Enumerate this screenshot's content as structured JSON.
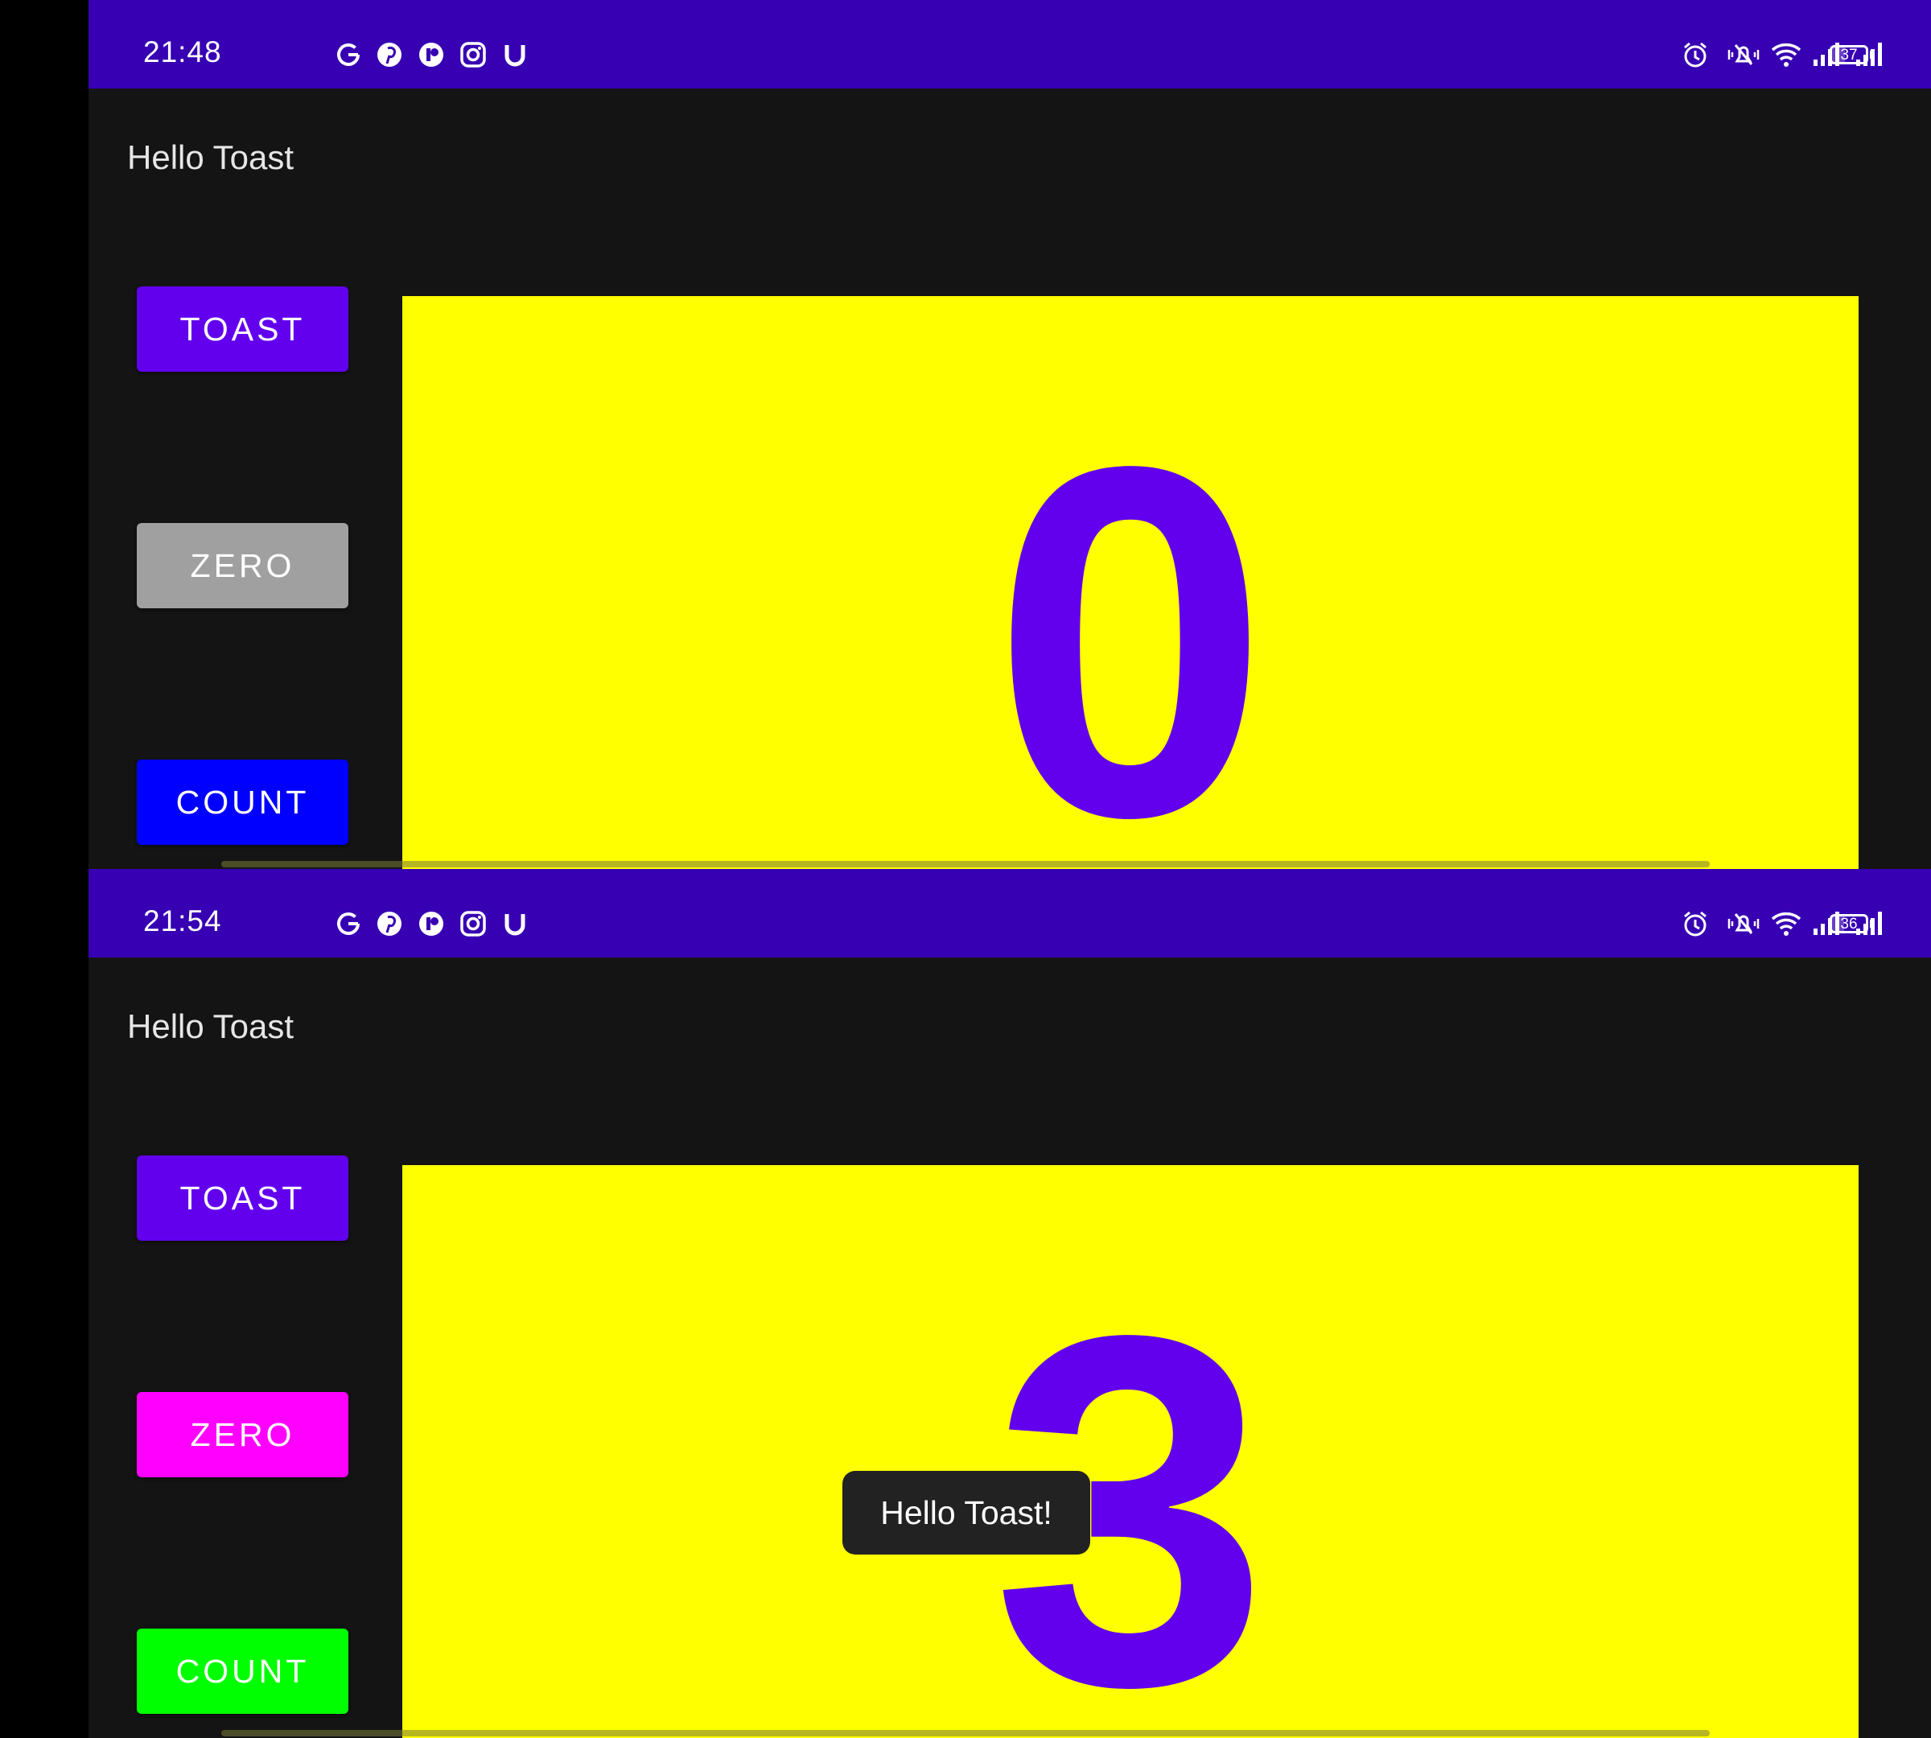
{
  "screens": [
    {
      "status_bar": {
        "time": "21:48",
        "notification_icons": [
          "google-icon",
          "pinterest-icon",
          "app-icon",
          "instagram-icon",
          "u-icon"
        ],
        "system_icons": [
          "alarm-icon",
          "vibrate-muted-icon",
          "wifi-icon",
          "signal-icon",
          "signal-icon"
        ],
        "battery_level": "37"
      },
      "app_title": "Hello Toast",
      "buttons": {
        "toast": {
          "label": "TOAST",
          "color": "#6200EE"
        },
        "zero": {
          "label": "ZERO",
          "color": "#A0A0A0"
        },
        "count": {
          "label": "COUNT",
          "color": "#0000FF"
        }
      },
      "count_panel": {
        "value": "0",
        "background": "#FFFF00",
        "text_color": "#6200EE"
      }
    },
    {
      "status_bar": {
        "time": "21:54",
        "notification_icons": [
          "google-icon",
          "pinterest-icon",
          "app-icon",
          "instagram-icon",
          "u-icon"
        ],
        "system_icons": [
          "alarm-icon",
          "vibrate-muted-icon",
          "wifi-icon",
          "signal-icon",
          "signal-icon"
        ],
        "battery_level": "36"
      },
      "app_title": "Hello Toast",
      "buttons": {
        "toast": {
          "label": "TOAST",
          "color": "#6200EE"
        },
        "zero": {
          "label": "ZERO",
          "color": "#FF00FF"
        },
        "count": {
          "label": "COUNT",
          "color": "#00FF00"
        }
      },
      "count_panel": {
        "value": "3",
        "background": "#FFFF00",
        "text_color": "#6200EE"
      },
      "toast_message": "Hello Toast!"
    }
  ],
  "colors": {
    "status_bar": "#3700B3",
    "app_background": "#141414",
    "toast_background": "#222222"
  }
}
